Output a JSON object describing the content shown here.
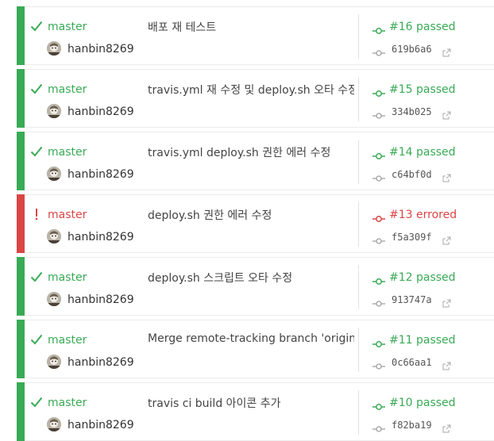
{
  "colors": {
    "passed": "#39aa56",
    "errored": "#db4545",
    "text": "#444444",
    "hash": "#555555"
  },
  "builds": [
    {
      "status": "passed",
      "branch": "master",
      "author": "hanbin8269",
      "message": "배포 재 테스트",
      "build": "#16 passed",
      "hash": "619b6a6"
    },
    {
      "status": "passed",
      "branch": "master",
      "author": "hanbin8269",
      "message": "travis.yml 재 수정 및 deploy.sh 오타 수정",
      "build": "#15 passed",
      "hash": "334b025"
    },
    {
      "status": "passed",
      "branch": "master",
      "author": "hanbin8269",
      "message": "travis.yml deploy.sh 권한 에러 수정",
      "build": "#14 passed",
      "hash": "c64bf0d"
    },
    {
      "status": "errored",
      "branch": "master",
      "author": "hanbin8269",
      "message": "deploy.sh 권한 에러 수정",
      "build": "#13 errored",
      "hash": "f5a309f"
    },
    {
      "status": "passed",
      "branch": "master",
      "author": "hanbin8269",
      "message": "deploy.sh 스크립트 오타 수정",
      "build": "#12 passed",
      "hash": "913747a"
    },
    {
      "status": "passed",
      "branch": "master",
      "author": "hanbin8269",
      "message": "Merge remote-tracking branch 'origin/master'",
      "build": "#11 passed",
      "hash": "0c66aa1"
    },
    {
      "status": "passed",
      "branch": "master",
      "author": "hanbin8269",
      "message": "travis ci build 아이콘 추가",
      "build": "#10 passed",
      "hash": "f82ba19"
    }
  ]
}
